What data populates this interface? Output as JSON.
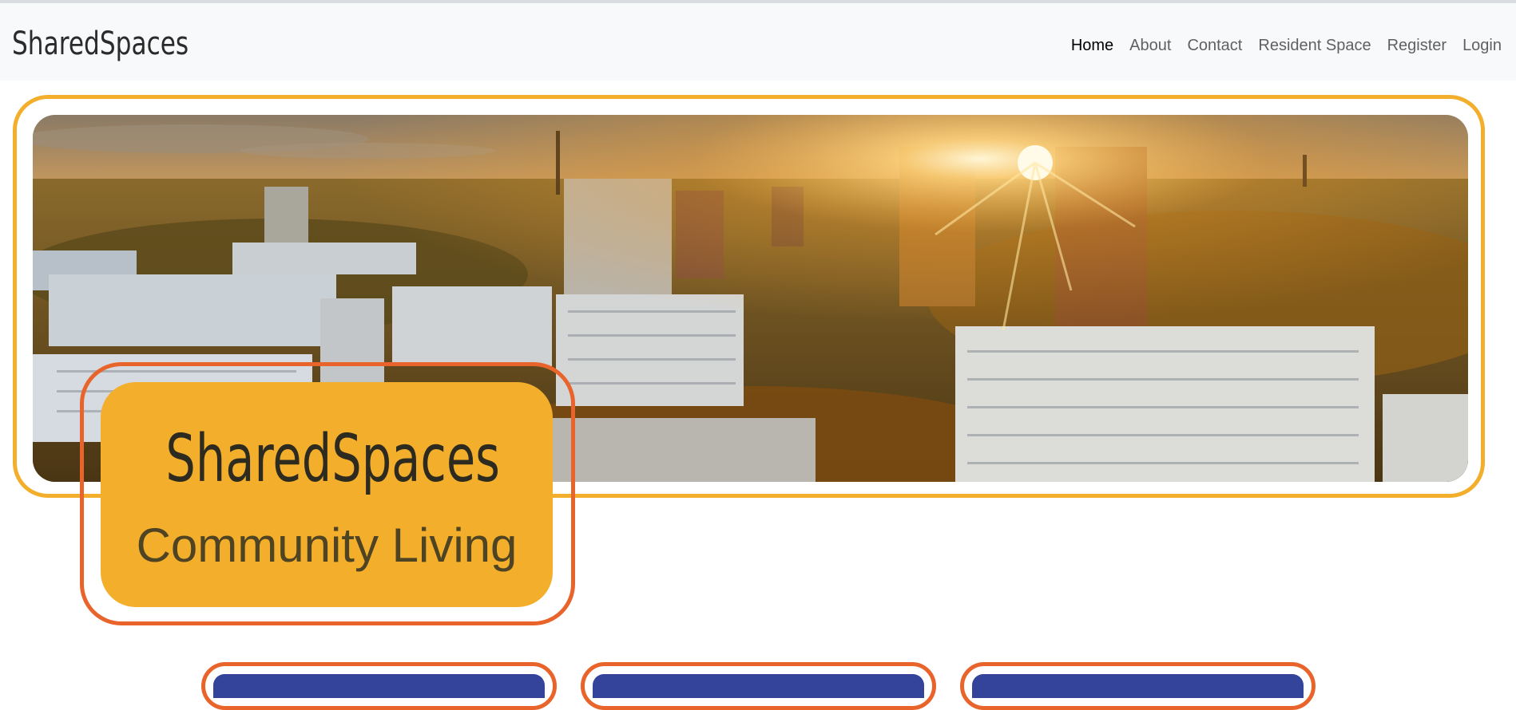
{
  "brand": "SharedSpaces",
  "nav": {
    "items": [
      {
        "label": "Home",
        "active": true
      },
      {
        "label": "About",
        "active": false
      },
      {
        "label": "Contact",
        "active": false
      },
      {
        "label": "Resident Space",
        "active": false
      },
      {
        "label": "Register",
        "active": false
      },
      {
        "label": "Login",
        "active": false
      }
    ]
  },
  "hero": {
    "image": "city-sunrise-apartment-blocks",
    "title": "SharedSpaces",
    "subtitle": "Community Living"
  },
  "cards": [
    {
      "color": "#34449a"
    },
    {
      "color": "#34449a"
    },
    {
      "color": "#34449a"
    }
  ],
  "colors": {
    "accent_orange": "#f3af2c",
    "ring_orange": "#e8642a",
    "card_blue": "#34449a",
    "navbar_bg": "#f8f9fa"
  }
}
